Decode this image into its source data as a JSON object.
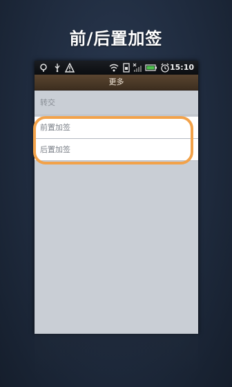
{
  "headline": "前/后置加签",
  "statusbar": {
    "time": "15:10",
    "icons": [
      "location-icon",
      "usb-icon",
      "warning-icon",
      "wifi-icon",
      "sim-icon",
      "no-signal-icon",
      "battery-icon",
      "alarm-icon"
    ]
  },
  "titlebar": {
    "title": "更多"
  },
  "section": {
    "header": "转交"
  },
  "menu": {
    "items": [
      {
        "label": "前置加签"
      },
      {
        "label": "后置加签"
      }
    ]
  },
  "colors": {
    "highlight": "#f2a24a",
    "titlebar": "#4a3826",
    "content_bg": "#c9ced5"
  }
}
